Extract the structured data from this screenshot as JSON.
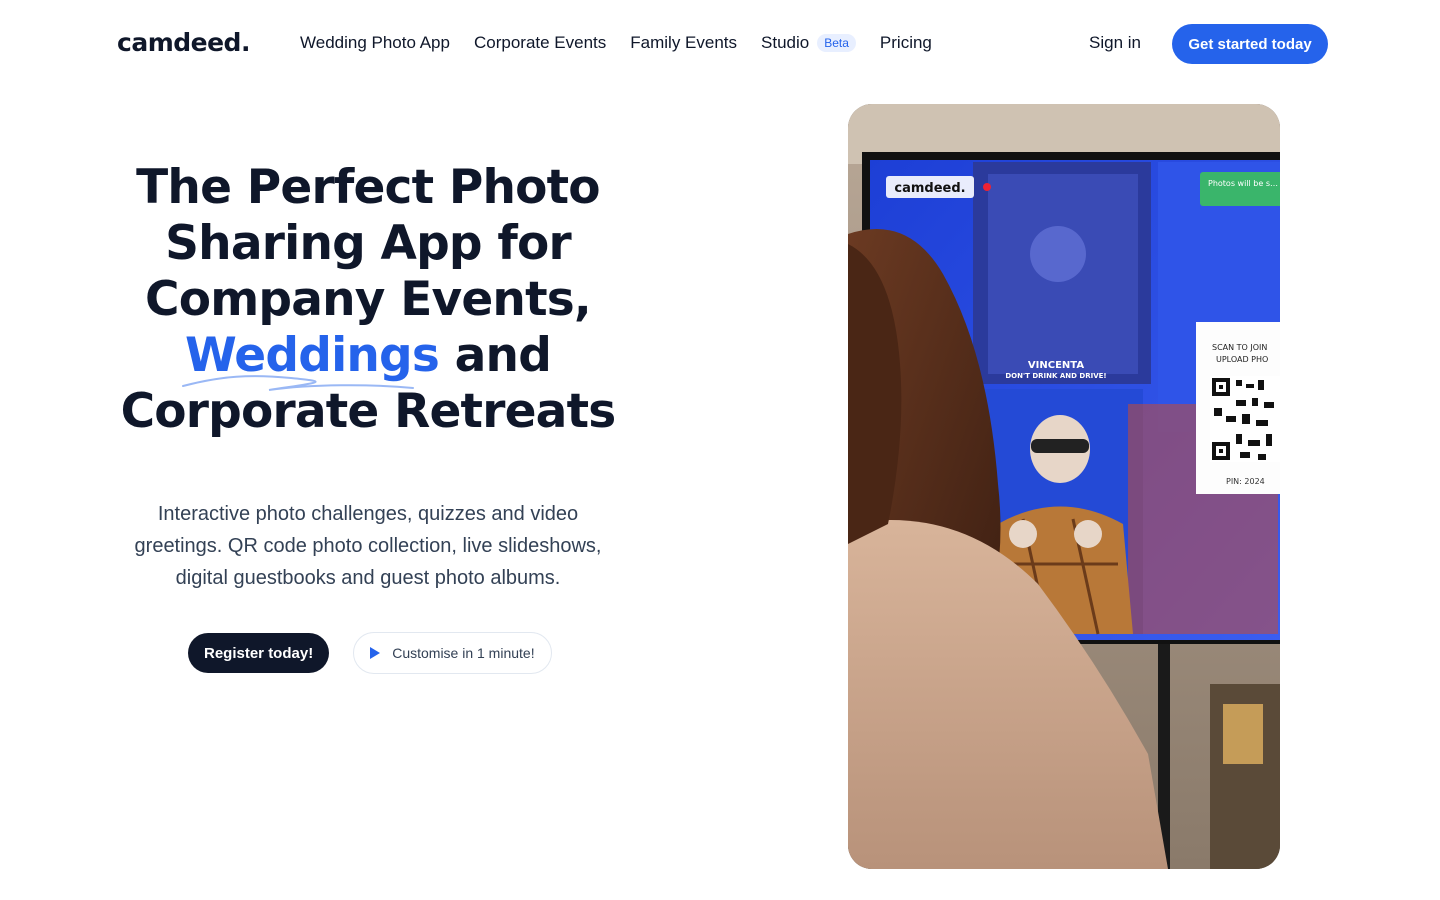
{
  "brand": {
    "logo": "camdeed."
  },
  "nav": {
    "links": [
      {
        "label": "Wedding Photo App"
      },
      {
        "label": "Corporate Events"
      },
      {
        "label": "Family Events"
      },
      {
        "label": "Studio",
        "badge": "Beta"
      },
      {
        "label": "Pricing"
      }
    ],
    "signin": "Sign in",
    "cta": "Get started today"
  },
  "hero": {
    "headline_line1": "The Perfect Photo",
    "headline_line2": "Sharing App for",
    "headline_line3": "Company Events,",
    "headline_accent": "Weddings",
    "headline_after_accent": " and",
    "headline_line5": "Corporate Retreats",
    "subtext": "Interactive photo challenges, quizzes and video greetings. QR code photo collection, live slideshows, digital guestbooks and guest photo albums.",
    "primary_button": "Register today!",
    "secondary_button": "Customise in 1 minute!"
  },
  "photo": {
    "screen_logo": "camdeed.",
    "toast": "Photos will be s… seconds.",
    "caption_name": "VINCENTA",
    "caption_sub": "DON'T DRINK AND DRIVE!",
    "qr_title_1": "SCAN TO JOIN",
    "qr_title_2": "UPLOAD PHO",
    "qr_pin": "PIN: 2024"
  },
  "colors": {
    "accent": "#2563eb",
    "dark": "#0f172a",
    "text": "#334155"
  }
}
